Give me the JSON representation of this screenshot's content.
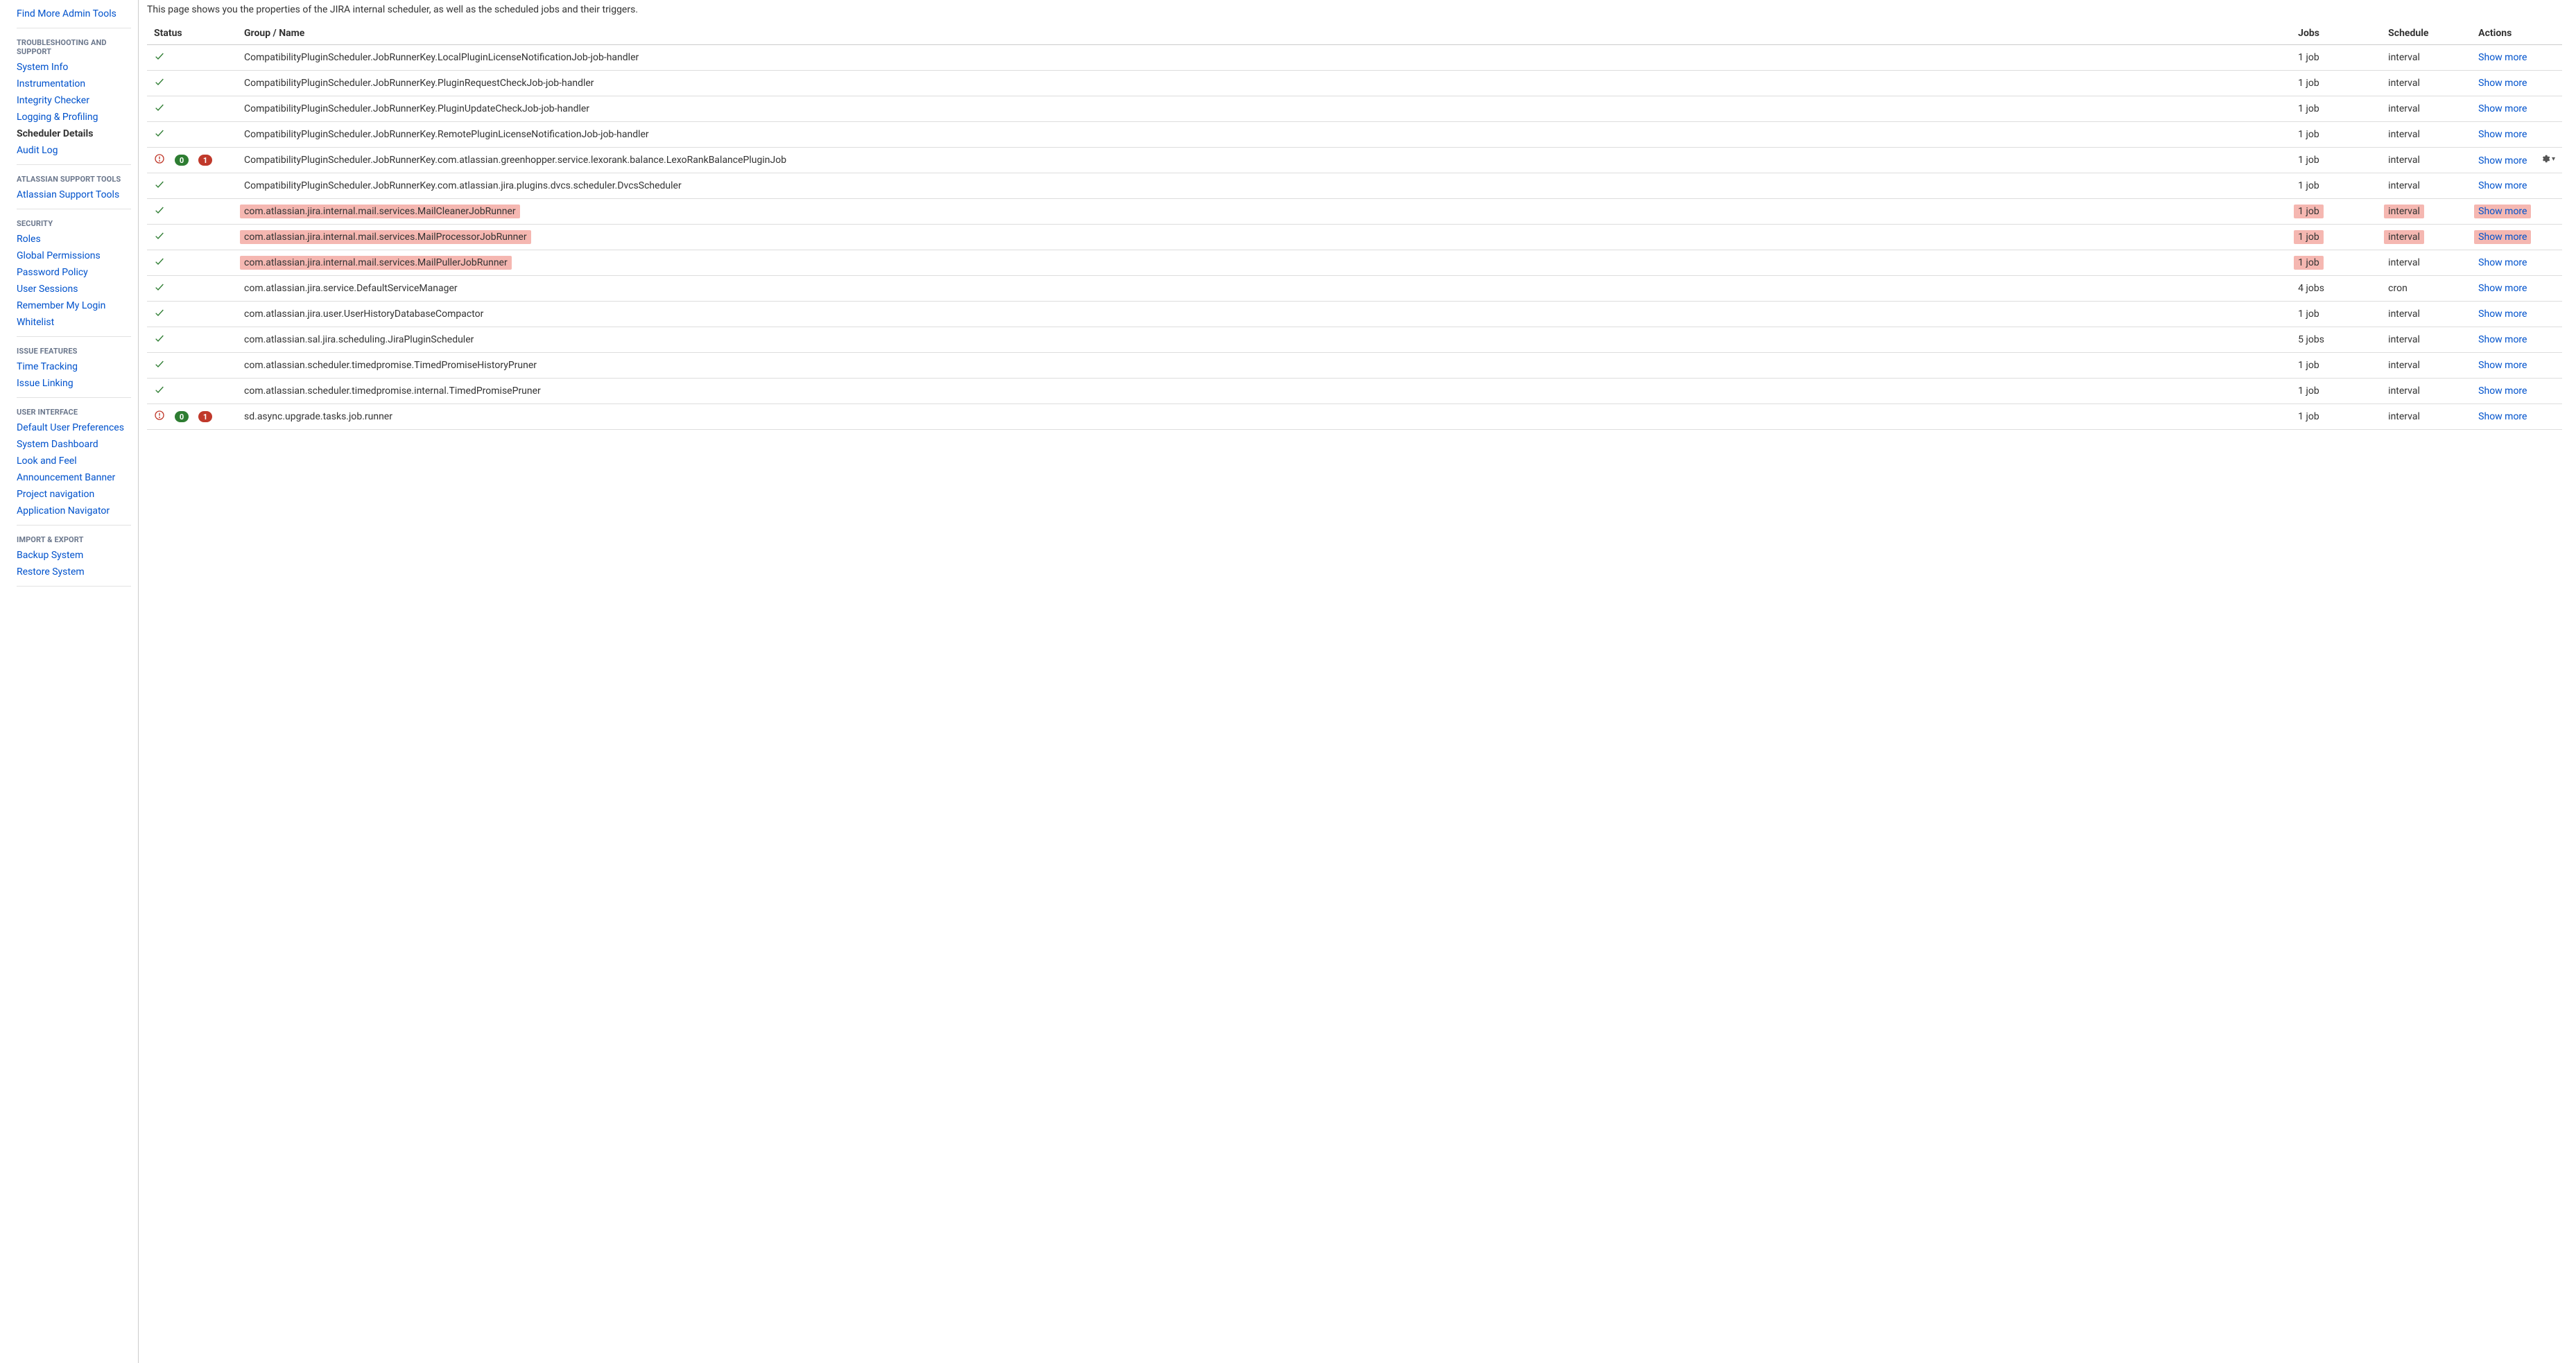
{
  "intro_text": "This page shows you the properties of the JIRA internal scheduler, as well as the scheduled jobs and their triggers.",
  "columns": {
    "status": "Status",
    "name": "Group / Name",
    "jobs": "Jobs",
    "schedule": "Schedule",
    "actions": "Actions"
  },
  "show_more_label": "Show more",
  "sidebar": {
    "top_link": "Find More Admin Tools",
    "groups": [
      {
        "label": "TROUBLESHOOTING AND SUPPORT",
        "items": [
          {
            "label": "System Info",
            "active": false
          },
          {
            "label": "Instrumentation",
            "active": false
          },
          {
            "label": "Integrity Checker",
            "active": false
          },
          {
            "label": "Logging & Profiling",
            "active": false
          },
          {
            "label": "Scheduler Details",
            "active": true
          },
          {
            "label": "Audit Log",
            "active": false
          }
        ]
      },
      {
        "label": "ATLASSIAN SUPPORT TOOLS",
        "items": [
          {
            "label": "Atlassian Support Tools",
            "active": false
          }
        ]
      },
      {
        "label": "SECURITY",
        "items": [
          {
            "label": "Roles",
            "active": false
          },
          {
            "label": "Global Permissions",
            "active": false
          },
          {
            "label": "Password Policy",
            "active": false
          },
          {
            "label": "User Sessions",
            "active": false
          },
          {
            "label": "Remember My Login",
            "active": false
          },
          {
            "label": "Whitelist",
            "active": false
          }
        ]
      },
      {
        "label": "ISSUE FEATURES",
        "items": [
          {
            "label": "Time Tracking",
            "active": false
          },
          {
            "label": "Issue Linking",
            "active": false
          }
        ]
      },
      {
        "label": "USER INTERFACE",
        "items": [
          {
            "label": "Default User Preferences",
            "active": false
          },
          {
            "label": "System Dashboard",
            "active": false
          },
          {
            "label": "Look and Feel",
            "active": false
          },
          {
            "label": "Announcement Banner",
            "active": false
          },
          {
            "label": "Project navigation",
            "active": false
          },
          {
            "label": "Application Navigator",
            "active": false
          }
        ]
      },
      {
        "label": "IMPORT & EXPORT",
        "items": [
          {
            "label": "Backup System",
            "active": false
          },
          {
            "label": "Restore System",
            "active": false
          }
        ]
      }
    ]
  },
  "rows": [
    {
      "status": "ok",
      "name": "CompatibilityPluginScheduler.JobRunnerKey.LocalPluginLicenseNotificationJob-job-handler",
      "jobs": "1 job",
      "schedule": "interval"
    },
    {
      "status": "ok",
      "name": "CompatibilityPluginScheduler.JobRunnerKey.PluginRequestCheckJob-job-handler",
      "jobs": "1 job",
      "schedule": "interval"
    },
    {
      "status": "ok",
      "name": "CompatibilityPluginScheduler.JobRunnerKey.PluginUpdateCheckJob-job-handler",
      "jobs": "1 job",
      "schedule": "interval"
    },
    {
      "status": "ok",
      "name": "CompatibilityPluginScheduler.JobRunnerKey.RemotePluginLicenseNotificationJob-job-handler",
      "jobs": "1 job",
      "schedule": "interval"
    },
    {
      "status": "warn",
      "green_badge": "0",
      "red_badge": "1",
      "name": "CompatibilityPluginScheduler.JobRunnerKey.com.atlassian.greenhopper.service.lexorank.balance.LexoRankBalancePluginJob",
      "jobs": "1 job",
      "schedule": "interval",
      "gear": true
    },
    {
      "status": "ok",
      "name": "CompatibilityPluginScheduler.JobRunnerKey.com.atlassian.jira.plugins.dvcs.scheduler.DvcsScheduler",
      "jobs": "1 job",
      "schedule": "interval"
    },
    {
      "status": "ok",
      "hl_name": true,
      "hl_jobs": true,
      "hl_sched": true,
      "hl_action": true,
      "name": "com.atlassian.jira.internal.mail.services.MailCleanerJobRunner",
      "jobs": "1 job",
      "schedule": "interval"
    },
    {
      "status": "ok",
      "hl_name": true,
      "hl_jobs": true,
      "hl_sched": true,
      "hl_action": true,
      "name": "com.atlassian.jira.internal.mail.services.MailProcessorJobRunner",
      "jobs": "1 job",
      "schedule": "interval"
    },
    {
      "status": "ok",
      "hl_name": true,
      "hl_jobs": true,
      "name": "com.atlassian.jira.internal.mail.services.MailPullerJobRunner",
      "jobs": "1 job",
      "schedule": "interval"
    },
    {
      "status": "ok",
      "name": "com.atlassian.jira.service.DefaultServiceManager",
      "jobs": "4 jobs",
      "schedule": "cron"
    },
    {
      "status": "ok",
      "name": "com.atlassian.jira.user.UserHistoryDatabaseCompactor",
      "jobs": "1 job",
      "schedule": "interval"
    },
    {
      "status": "ok",
      "name": "com.atlassian.sal.jira.scheduling.JiraPluginScheduler",
      "jobs": "5 jobs",
      "schedule": "interval"
    },
    {
      "status": "ok",
      "name": "com.atlassian.scheduler.timedpromise.TimedPromiseHistoryPruner",
      "jobs": "1 job",
      "schedule": "interval"
    },
    {
      "status": "ok",
      "name": "com.atlassian.scheduler.timedpromise.internal.TimedPromisePruner",
      "jobs": "1 job",
      "schedule": "interval"
    },
    {
      "status": "warn",
      "green_badge": "0",
      "red_badge": "1",
      "name": "sd.async.upgrade.tasks.job.runner",
      "jobs": "1 job",
      "schedule": "interval"
    }
  ]
}
